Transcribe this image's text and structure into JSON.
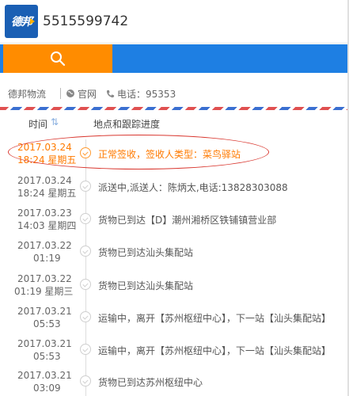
{
  "search": {
    "query": "5515599742",
    "logo_text": "德邦"
  },
  "company": {
    "name": "德邦物流",
    "website_label": "官网",
    "phone_label": "电话：95353"
  },
  "header": {
    "time_label": "时间",
    "sort_indicator": "⇅",
    "location_label": "地点和跟踪进度"
  },
  "events": [
    {
      "date": "2017.03.24",
      "time": "18:24 星期五",
      "desc": "正常签收，签收人类型：菜鸟驿站",
      "active": true
    },
    {
      "date": "2017.03.24",
      "time": "18:24 星期五",
      "desc": "派送中,派送人：陈炳太,电话:13828303088",
      "active": false
    },
    {
      "date": "2017.03.23",
      "time": "14:03 星期四",
      "desc": "货物已到达【D】潮州湘桥区铁铺镇营业部",
      "active": false
    },
    {
      "date": "2017.03.22",
      "time": "01:19",
      "desc": "货物已到达汕头集配站",
      "active": false
    },
    {
      "date": "2017.03.22",
      "time": "01:19 星期三",
      "desc": "货物已到达汕头集配站",
      "active": false
    },
    {
      "date": "2017.03.21",
      "time": "05:53",
      "desc": "运输中，离开【苏州枢纽中心】，下一站【汕头集配站】",
      "active": false
    },
    {
      "date": "2017.03.21",
      "time": "05:53",
      "desc": "运输中，离开【苏州枢纽中心】，下一站【汕头集配站】",
      "active": false
    },
    {
      "date": "2017.03.21",
      "time": "03:09",
      "desc": "货物已到达苏州枢纽中心",
      "active": false
    }
  ],
  "colors": {
    "brand_blue": "#1e7fe3",
    "search_orange": "#ff8c00",
    "active_orange": "#ff7a00",
    "annotation_red": "#d9372f"
  }
}
